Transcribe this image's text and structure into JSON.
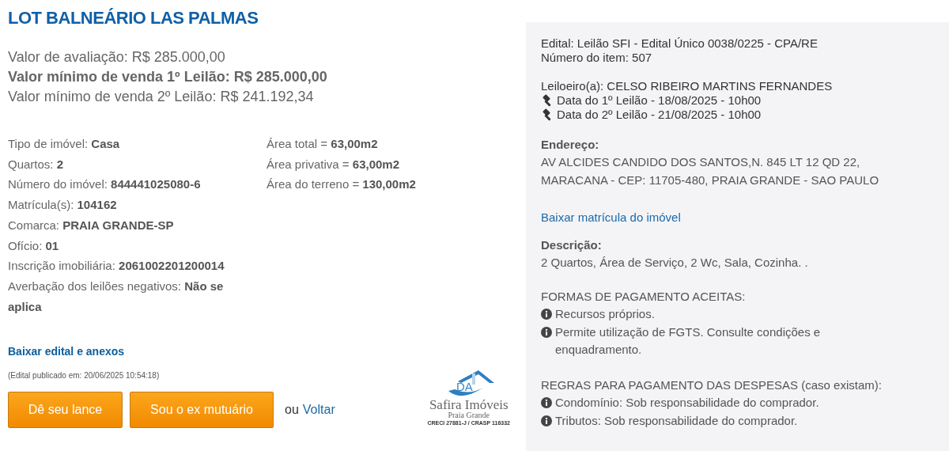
{
  "title": "LOT BALNEÁRIO LAS PALMAS",
  "valuations": [
    {
      "text": "Valor de avaliação: R$ 285.000,00",
      "bold": false
    },
    {
      "text": "Valor mínimo de venda 1º Leilão: R$ 285.000,00",
      "bold": true
    },
    {
      "text": "Valor mínimo de venda 2º Leilão: R$ 241.192,34",
      "bold": false
    }
  ],
  "details": [
    {
      "label": "Tipo de imóvel:",
      "value": "Casa"
    },
    {
      "label": "Quartos:",
      "value": "2"
    },
    {
      "label": "Número do imóvel:",
      "value": "844441025080-6"
    },
    {
      "label": "Matrícula(s):",
      "value": "104162"
    },
    {
      "label": "Comarca:",
      "value": "PRAIA GRANDE-SP"
    },
    {
      "label": "Ofício:",
      "value": "01"
    },
    {
      "label": "Inscrição imobiliária:",
      "value": "2061002201200014"
    },
    {
      "label": "Averbação dos leilões negativos:",
      "value": "Não se aplica"
    }
  ],
  "areas": [
    {
      "label": "Área total =",
      "value": "63,00m2"
    },
    {
      "label": "Área privativa =",
      "value": "63,00m2"
    },
    {
      "label": "Área do terreno =",
      "value": "130,00m2"
    }
  ],
  "download_link": "Baixar edital e anexos",
  "published": "(Edital publicado em: 20/06/2025 10:54:18)",
  "buttons": [
    "Dê seu lance",
    "Sou o ex mutuário"
  ],
  "or_text": "ou",
  "back_link": "Voltar",
  "logo": {
    "initials": "DA",
    "name": "Safira Imóveis",
    "city": "Praia Grande",
    "registry": "CRECI 27881-J / CRASP 116332"
  },
  "panel": {
    "edital": "Edital: Leilão SFI - Edital Único 0038/0225 - CPA/RE",
    "item_number": "Número do item: 507",
    "auctioneer": "Leiloeiro(a): CELSO RIBEIRO MARTINS FERNANDES",
    "dates": [
      "Data do 1º Leilão - 18/08/2025 - 10h00",
      "Data do 2º Leilão - 21/08/2025 - 10h00"
    ],
    "address_heading": "Endereço:",
    "address": "AV ALCIDES CANDIDO DOS SANTOS,N. 845 LT 12 QD 22, MARACANA - CEP: 11705-480, PRAIA GRANDE - SAO PAULO",
    "registry_link": "Baixar matrícula do imóvel",
    "description_heading": "Descrição:",
    "description": "2 Quartos, Área de Serviço, 2 Wc, Sala, Cozinha. .",
    "payment_heading": "FORMAS DE PAGAMENTO ACEITAS:",
    "payment_items": [
      "Recursos próprios.",
      "Permite utilização de FGTS. Consulte condições e enquadramento."
    ],
    "expenses_heading": "REGRAS PARA PAGAMENTO DAS DESPESAS (caso existam):",
    "expense_items": [
      "Condomínio: Sob responsabilidade do comprador.",
      "Tributos: Sob responsabilidade do comprador."
    ]
  }
}
